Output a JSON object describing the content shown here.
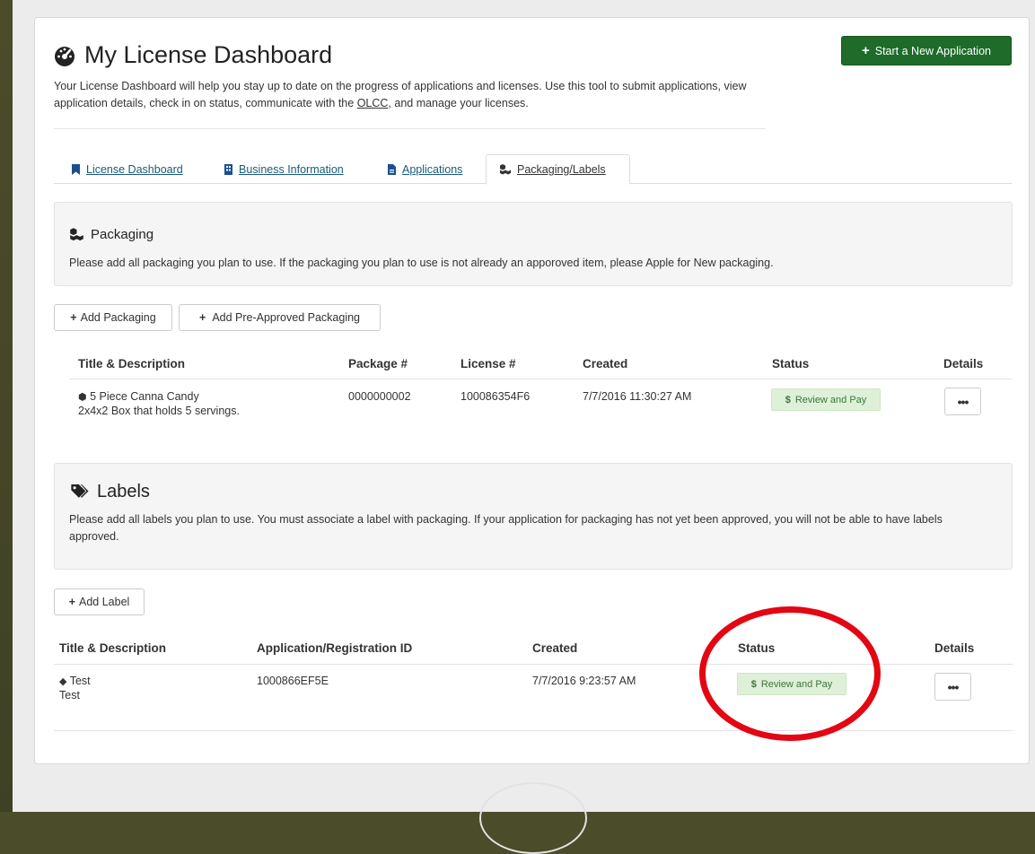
{
  "header": {
    "title": "My License Dashboard",
    "intro_before": "Your License Dashboard will help you stay up to date on the progress of applications and licenses. Use this tool to submit applications, view application details, check in on status, communicate with the ",
    "intro_link": "OLCC",
    "intro_after": ", and manage your licenses.",
    "new_app_label": "Start a New Application"
  },
  "tabs": [
    {
      "label": "License Dashboard",
      "icon": "bookmark-icon"
    },
    {
      "label": "Business Information",
      "icon": "building-icon"
    },
    {
      "label": "Applications",
      "icon": "file-icon"
    },
    {
      "label": "Packaging/Labels",
      "icon": "cubes-icon",
      "active": true
    }
  ],
  "packaging": {
    "heading": "Packaging",
    "text": "Please add all packaging you plan to use. If the packaging you plan to use is not already an apporoved item, please Apple for New packaging.",
    "add_label": "Add Packaging",
    "add_pre_label": "Add Pre-Approved Packaging",
    "columns": [
      "Title & Description",
      "Package #",
      "License #",
      "Created",
      "Status",
      "Details"
    ],
    "rows": [
      {
        "title": "5 Piece Canna Candy",
        "description": "2x4x2 Box that holds 5 servings.",
        "package_no": "0000000002",
        "license_no": "100086354F6",
        "created": "7/7/2016 11:30:27 AM",
        "status": "Review and Pay",
        "details": "•••"
      }
    ]
  },
  "labels": {
    "heading": "Labels",
    "text": "Please add all labels you plan to use. You must associate a label with packaging. If your application for packaging has not yet been approved, you will not be able to have labels approved.",
    "add_label": "Add Label",
    "columns": [
      "Title & Description",
      "Application/Registration ID",
      "Created",
      "Status",
      "Details"
    ],
    "rows": [
      {
        "title": "Test",
        "description": "Test",
        "app_id": "1000866EF5E",
        "created": "7/7/2016 9:23:57 AM",
        "status": "Review and Pay",
        "details": "•••"
      }
    ]
  },
  "colors": {
    "primary_button": "#1e6b2a",
    "badge_bg": "#dff0d8",
    "badge_text": "#3c763d",
    "highlight_circle": "#e30613",
    "outer_background": "#4a4c2a"
  }
}
